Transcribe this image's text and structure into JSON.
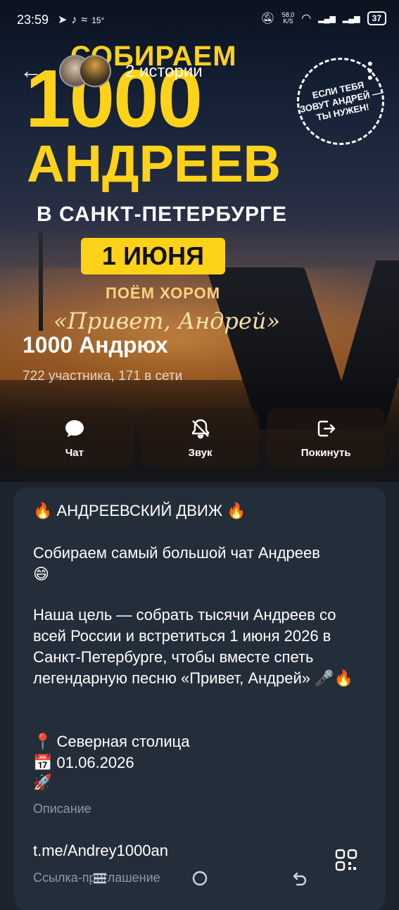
{
  "status_bar": {
    "time": "23:59",
    "left_icons": [
      "telegram-icon",
      "tiktok-icon",
      "wind-icon"
    ],
    "temperature": "15°",
    "speed": "58,0",
    "speed_unit": "K/S",
    "battery": "37"
  },
  "header": {
    "stories_label": "2 истории"
  },
  "poster": {
    "line1": "СОБИРАЕМ",
    "line2": "1000",
    "line3": "АНДРЕЕВ",
    "city": "В САНКТ-ПЕТЕРБУРГЕ",
    "date": "1 ИЮНЯ",
    "sing": "ПОЁМ ХОРОМ",
    "song": "«Привет, Андрей»",
    "badge": "ЕСЛИ ТЕБЯ ЗОВУТ АНДРЕЙ — ТЫ НУЖЕН!"
  },
  "group": {
    "title": "1000 Андрюх",
    "subtitle": "722 участника, 171 в сети"
  },
  "actions": [
    {
      "label": "Чат",
      "icon": "chat-icon"
    },
    {
      "label": "Звук",
      "icon": "mute-bell-icon"
    },
    {
      "label": "Покинуть",
      "icon": "leave-icon"
    }
  ],
  "info": {
    "heading": "АНДРЕЕВСКИЙ ДВИЖ",
    "p1": "Собираем самый большой чат Андреев",
    "p2": "Наша цель — собрать тысячи Андреев со всей России и встретиться 1 июня 2026 в Санкт-Петербурге, чтобы вместе спеть легендарную песню «Привет, Андрей»",
    "location": "Северная столица",
    "date": "01.06.2026",
    "description_label": "Описание",
    "link": "t.me/Andrey1000an",
    "link_label": "Ссылка-приглашение"
  },
  "colors": {
    "poster_yellow": "#ffd21a",
    "card_bg": "#242e3a",
    "page_bg": "#1c242e",
    "muted_text": "#8d99a6"
  }
}
